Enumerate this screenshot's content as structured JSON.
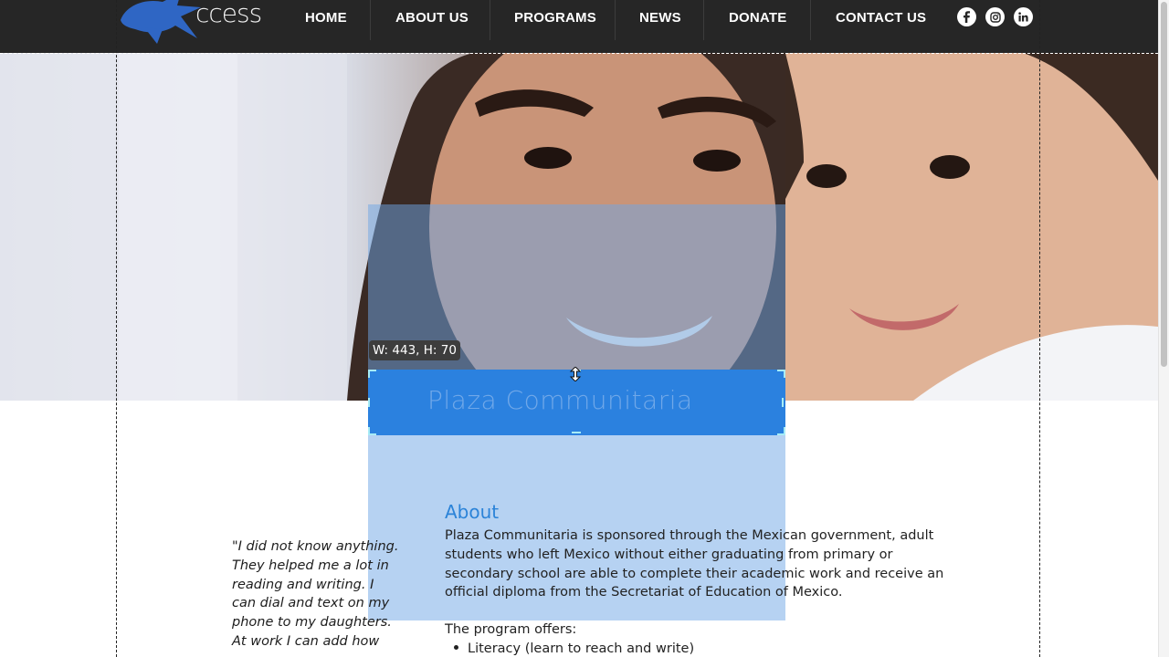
{
  "logo": {
    "text": "ccess"
  },
  "nav": {
    "items": [
      {
        "label": "HOME"
      },
      {
        "label": "ABOUT US"
      },
      {
        "label": "PROGRAMS"
      },
      {
        "label": "NEWS"
      },
      {
        "label": "DONATE"
      },
      {
        "label": "CONTACT US"
      }
    ]
  },
  "social": {
    "icons": [
      "facebook-icon",
      "instagram-icon",
      "linkedin-icon"
    ]
  },
  "editor": {
    "size_tooltip": "W: 443, H: 70",
    "selected_title": "Plaza Communitaria"
  },
  "quote": {
    "lines": [
      "\"I did not know anything.",
      " They helped me a lot in",
      "reading and writing.  I",
      "can dial and text on my",
      "phone to my daughters.",
      " At work I can add how"
    ]
  },
  "about": {
    "heading": "About",
    "lines": [
      "Plaza Communitaria is sponsored through the Mexican government, adult",
      "students who left Mexico without either graduating from primary or",
      "secondary school are able to complete their academic work and receive an",
      "official diploma from the Secretariat of Education of Mexico."
    ],
    "offers_label": "The program offers:",
    "offers": [
      "Literacy (learn to reach and write)"
    ]
  },
  "colors": {
    "header_bg": "#262626",
    "accent_blue": "#2b83d8",
    "selection_blue": "#2b81df",
    "handle_cyan": "#a7ecf6"
  }
}
